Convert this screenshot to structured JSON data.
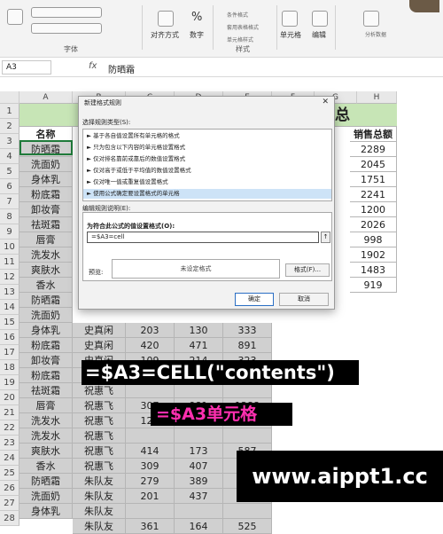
{
  "ribbon": {
    "groups": {
      "font": "字体",
      "style": "样式"
    },
    "buttons": {
      "align": "对齐方式",
      "number": "数字",
      "percent": "%",
      "cells": "单元格",
      "edit": "编辑",
      "cond_format": "条件格式",
      "table_format": "套用表格格式",
      "cell_style": "单元格样式",
      "analysis": "分析数据"
    }
  },
  "formula_bar": {
    "name_box": "A3",
    "fx": "fx",
    "value": "防晒霜"
  },
  "columns": [
    "A",
    "B",
    "C",
    "D",
    "E",
    "F",
    "G",
    "H"
  ],
  "rows": [
    "1",
    "2",
    "3",
    "4",
    "5",
    "6",
    "7",
    "8",
    "9",
    "10",
    "11",
    "12",
    "13",
    "14",
    "15",
    "16",
    "17",
    "18",
    "19",
    "20",
    "21",
    "22",
    "23",
    "24",
    "25",
    "26",
    "27",
    "28"
  ],
  "sheet": {
    "title_fragment": "汇总",
    "header_name": "名称",
    "header_sales": "销售总额",
    "names": [
      "防晒霜",
      "洗面奶",
      "身体乳",
      "粉底霜",
      "卸妆膏",
      "祛斑霜",
      "唇膏",
      "洗发水",
      "爽肤水",
      "香水",
      "防晒霜",
      "洗面奶",
      "身体乳",
      "粉底霜",
      "卸妆膏",
      "粉底霜",
      "祛斑霜",
      "唇膏",
      "洗发水",
      "洗发水",
      "爽肤水",
      "香水",
      "防晒霜",
      "洗面奶",
      "身体乳"
    ],
    "sales_totals": [
      "2289",
      "2045",
      "1751",
      "2241",
      "1200",
      "2026",
      "998",
      "1902",
      "1483",
      "919"
    ],
    "detail_rows": [
      {
        "b": "史真闲",
        "c": "203",
        "d": "130",
        "e": "333"
      },
      {
        "b": "史真闲",
        "c": "420",
        "d": "471",
        "e": "891"
      },
      {
        "b": "史真闲",
        "c": "109",
        "d": "214",
        "e": "323"
      },
      {
        "b": "史真闲",
        "c": "",
        "d": "",
        "e": ""
      },
      {
        "b": "祝惠飞",
        "c": "",
        "d": "",
        "e": ""
      },
      {
        "b": "祝惠飞",
        "c": "307",
        "d": "981",
        "e": "1288"
      },
      {
        "b": "祝惠飞",
        "c": "129",
        "d": "",
        "e": ""
      },
      {
        "b": "祝惠飞",
        "c": "",
        "d": "",
        "e": ""
      },
      {
        "b": "祝惠飞",
        "c": "414",
        "d": "173",
        "e": "587"
      },
      {
        "b": "祝惠飞",
        "c": "309",
        "d": "407",
        "e": "716"
      },
      {
        "b": "朱队友",
        "c": "279",
        "d": "389",
        "e": ""
      },
      {
        "b": "朱队友",
        "c": "201",
        "d": "437",
        "e": ""
      },
      {
        "b": "朱队友",
        "c": "",
        "d": "",
        "e": ""
      },
      {
        "b": "朱队友",
        "c": "361",
        "d": "164",
        "e": "525"
      }
    ]
  },
  "dialog": {
    "title": "新建格式规则",
    "close": "✕",
    "select_type_label": "选择规则类型(S):",
    "types": [
      "► 基于各自值设置所有单元格的格式",
      "► 只为包含以下内容的单元格设置格式",
      "► 仅对排名靠前或靠后的数值设置格式",
      "► 仅对高于或低于平均值的数值设置格式",
      "► 仅对唯一值或重复值设置格式",
      "► 使用公式确定要设置格式的单元格"
    ],
    "edit_label": "编辑规则说明(E):",
    "formula_label": "为符合此公式的值设置格式(O):",
    "formula_value": "=$A3=cell",
    "preview_label": "预览:",
    "preview_text": "未设定格式",
    "format_button": "格式(F)...",
    "ok": "确定",
    "cancel": "取消"
  },
  "overlays": {
    "formula_caption": "=$A3=CELL(\"contents\")",
    "caption2": "=$A3单元格",
    "watermark": "www.aippt1.cc"
  }
}
